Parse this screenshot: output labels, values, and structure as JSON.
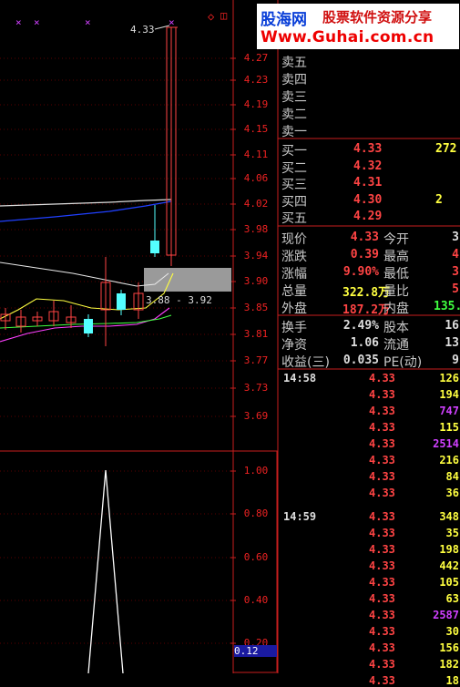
{
  "watermark": {
    "logo": "股海网",
    "slogan": "股票软件资源分享",
    "url": "Www.Guhai.com.cn"
  },
  "main_chart": {
    "y_ticks": [
      "4.27",
      "4.23",
      "4.19",
      "4.15",
      "4.11",
      "4.06",
      "4.02",
      "3.98",
      "3.94",
      "3.90",
      "3.85",
      "3.81",
      "3.77",
      "3.73",
      "3.69"
    ],
    "high_label": "4.33",
    "range_label": "3.88 - 3.92",
    "top_markers": [
      "×",
      "×",
      "×",
      "×"
    ],
    "corner_icons": [
      "◇",
      "◫"
    ]
  },
  "sub_chart": {
    "y_ticks": [
      "1.00",
      "0.80",
      "0.60",
      "0.40",
      "0.20"
    ],
    "value_badge": "0.12"
  },
  "order_book": {
    "sells": [
      {
        "label": "卖五"
      },
      {
        "label": "卖四"
      },
      {
        "label": "卖三"
      },
      {
        "label": "卖二"
      },
      {
        "label": "卖一"
      }
    ],
    "buys": [
      {
        "label": "买一",
        "price": "4.33",
        "vol": "272"
      },
      {
        "label": "买二",
        "price": "4.32",
        "vol": ""
      },
      {
        "label": "买三",
        "price": "4.31",
        "vol": ""
      },
      {
        "label": "买四",
        "price": "4.30",
        "vol": "2"
      },
      {
        "label": "买五",
        "price": "4.29",
        "vol": ""
      }
    ]
  },
  "quote": {
    "rows": [
      {
        "l1": "现价",
        "v1": "4.33",
        "l2": "今开",
        "v2": "3"
      },
      {
        "l1": "涨跌",
        "v1": "0.39",
        "l2": "最高",
        "v2": "4"
      },
      {
        "l1": "涨幅",
        "v1": "9.90%",
        "l2": "最低",
        "v2": "3"
      },
      {
        "l1": "总量",
        "v1": "322.8万",
        "l2": "量比",
        "v2": "5"
      },
      {
        "l1": "外盘",
        "v1": "187.2万",
        "l2": "内盘",
        "v2": "135."
      },
      {
        "l1": "换手",
        "v1": "2.49%",
        "l2": "股本",
        "v2": "16"
      },
      {
        "l1": "净资",
        "v1": "1.06",
        "l2": "流通",
        "v2": "13"
      },
      {
        "l1": "收益(三)",
        "v1": "0.035",
        "l2": "PE(动)",
        "v2": "9"
      }
    ]
  },
  "ticks": {
    "groups": [
      {
        "time": "14:58",
        "rows": [
          {
            "price": "4.33",
            "vol": "126"
          },
          {
            "price": "4.33",
            "vol": "194"
          },
          {
            "price": "4.33",
            "vol": "747"
          },
          {
            "price": "4.33",
            "vol": "115"
          },
          {
            "price": "4.33",
            "vol": "2514"
          },
          {
            "price": "4.33",
            "vol": "216"
          },
          {
            "price": "4.33",
            "vol": "84"
          },
          {
            "price": "4.33",
            "vol": "36"
          }
        ]
      },
      {
        "time": "14:59",
        "rows": [
          {
            "price": "4.33",
            "vol": "348"
          },
          {
            "price": "4.33",
            "vol": "35"
          },
          {
            "price": "4.33",
            "vol": "198"
          },
          {
            "price": "4.33",
            "vol": "442"
          },
          {
            "price": "4.33",
            "vol": "105"
          },
          {
            "price": "4.33",
            "vol": "63"
          },
          {
            "price": "4.33",
            "vol": "2587"
          },
          {
            "price": "4.33",
            "vol": "30"
          },
          {
            "price": "4.33",
            "vol": "156"
          },
          {
            "price": "4.33",
            "vol": "182"
          },
          {
            "price": "4.33",
            "vol": "18"
          }
        ]
      }
    ]
  },
  "colors": {
    "up": "#ff4444",
    "down": "#54ffff",
    "grid": "#c81e1e",
    "ma_white": "#ffffff",
    "ma_yellow": "#ffff40",
    "ma_magenta": "#ff40ff",
    "ma_green": "#40ff40",
    "ma_blue": "#2040ff",
    "vol_purple": "#d040ff",
    "vol_yellow": "#ffff40",
    "vol_green": "#40ff40",
    "label_gray": "#c8c8c8"
  }
}
